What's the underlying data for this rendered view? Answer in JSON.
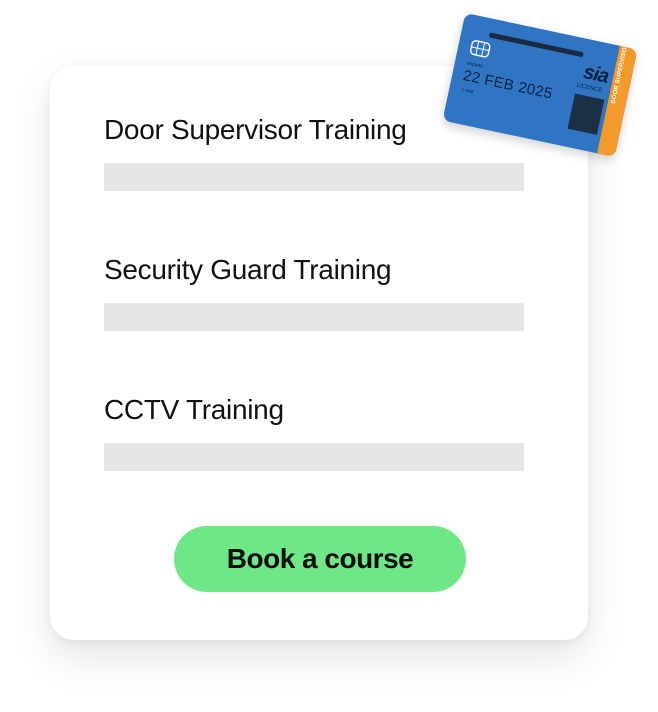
{
  "courses": [
    {
      "title": "Door Supervisor Training"
    },
    {
      "title": "Security Guard Training"
    },
    {
      "title": "CCTV Training"
    }
  ],
  "cta": {
    "label": "Book a course"
  },
  "licence": {
    "expiry_label": "expires",
    "date": "22 FEB 2025",
    "small_text": "1 use",
    "brand": "sia",
    "word": "LICENCE",
    "stripe_text": "DOOR SUPERVISOR"
  },
  "colors": {
    "cta_bg": "#6ee787",
    "card_blue": "#2f75c4",
    "card_orange": "#f39a2b",
    "placeholder_bar": "#e6e6e6"
  }
}
